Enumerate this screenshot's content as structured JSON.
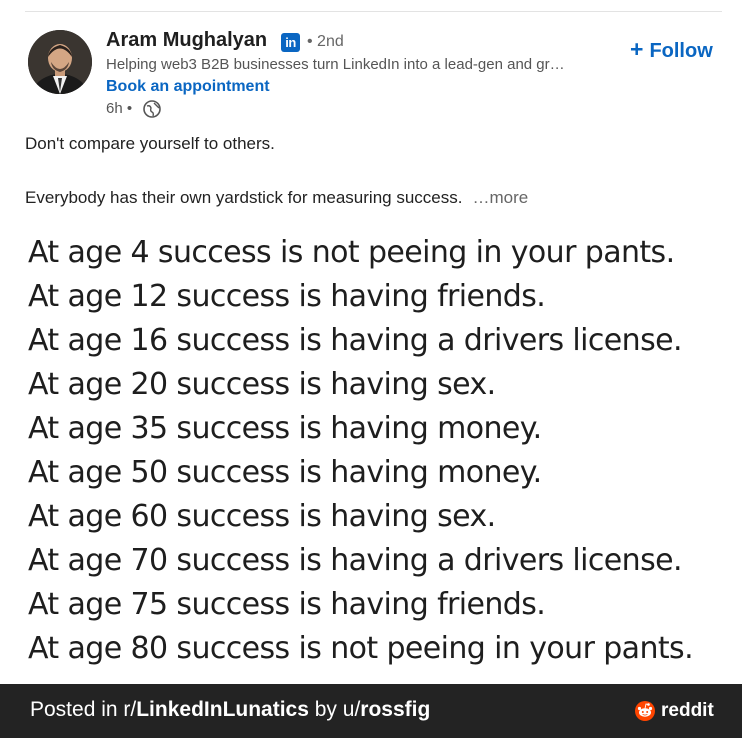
{
  "post": {
    "author": {
      "name": "Aram Mughalyan",
      "network_badge": "in",
      "degree": "• 2nd",
      "headline": "Helping web3 B2B businesses turn LinkedIn into a lead-gen and gr…",
      "cta": "Book an appointment",
      "time": "6h •"
    },
    "follow_label": "Follow",
    "text_line1": "Don't compare yourself to others.",
    "text_line2": "Everybody has their own yardstick for measuring success.",
    "more_label": "…more",
    "image_lines": [
      "At age 4 success is not peeing in your pants.",
      "At age 12 success is having friends.",
      "At age 16 success is having a drivers license.",
      "At age 20 success is having sex.",
      "At age 35 success is having money.",
      "At age 50 success is having money.",
      "At age 60 success is having sex.",
      "At age 70 success is having a drivers license.",
      "At age 75 success is having friends.",
      "At age 80 success is not peeing in your pants."
    ]
  },
  "footer": {
    "prefix": "Posted in r/",
    "subreddit": "LinkedInLunatics",
    "by": " by u/",
    "user": "rossfig",
    "brand": "reddit"
  },
  "colors": {
    "linkedin_blue": "#0a66c2",
    "footer_bg": "#232323",
    "reddit_orange": "#ff4500"
  },
  "icons": [
    "linkedin-icon",
    "globe-icon",
    "plus-icon",
    "reddit-icon"
  ]
}
